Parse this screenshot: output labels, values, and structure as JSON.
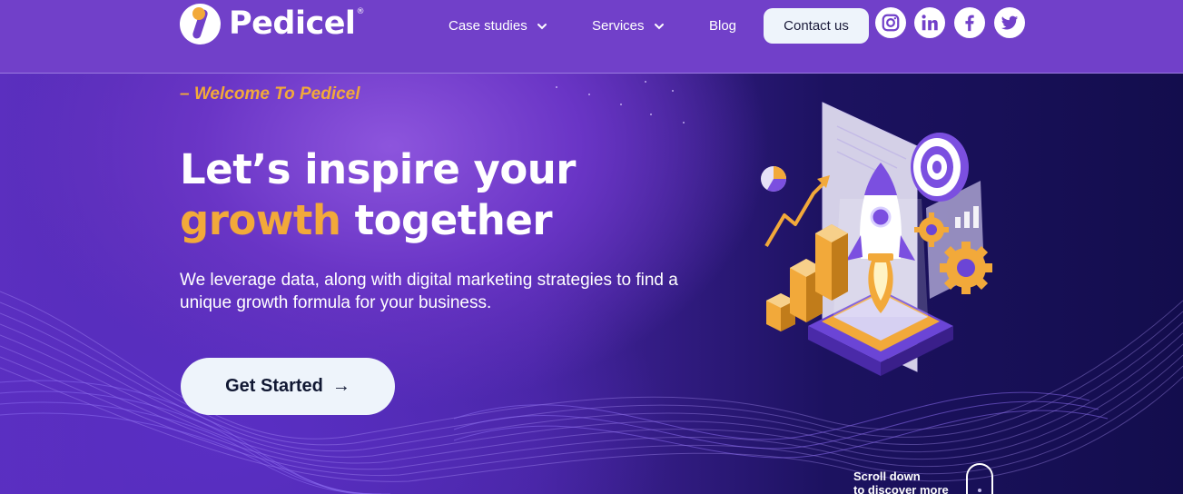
{
  "brand": {
    "name": "Pedicel",
    "reg": "®"
  },
  "nav": {
    "items": [
      {
        "label": "Case studies",
        "has_dropdown": true
      },
      {
        "label": "Services",
        "has_dropdown": true
      },
      {
        "label": "Blog",
        "has_dropdown": false
      }
    ],
    "contact_label": "Contact us",
    "social": [
      "instagram-icon",
      "linkedin-icon",
      "facebook-icon",
      "twitter-icon"
    ]
  },
  "hero": {
    "eyebrow": "– Welcome To Pedicel",
    "headline_line1": "Let’s inspire your",
    "headline_accent": "growth",
    "headline_rest": " together",
    "subtext": "We leverage data, along with digital marketing strategies to find a unique growth formula for your business.",
    "cta_label": "Get Started",
    "cta_arrow": "→",
    "scroll_line1": "Scroll down",
    "scroll_line2": "to discover more"
  },
  "colors": {
    "header_bg": "#7140c9",
    "accent": "#f2a93a",
    "button_bg": "#eef4fb",
    "hero_dark": "#130d4d"
  }
}
